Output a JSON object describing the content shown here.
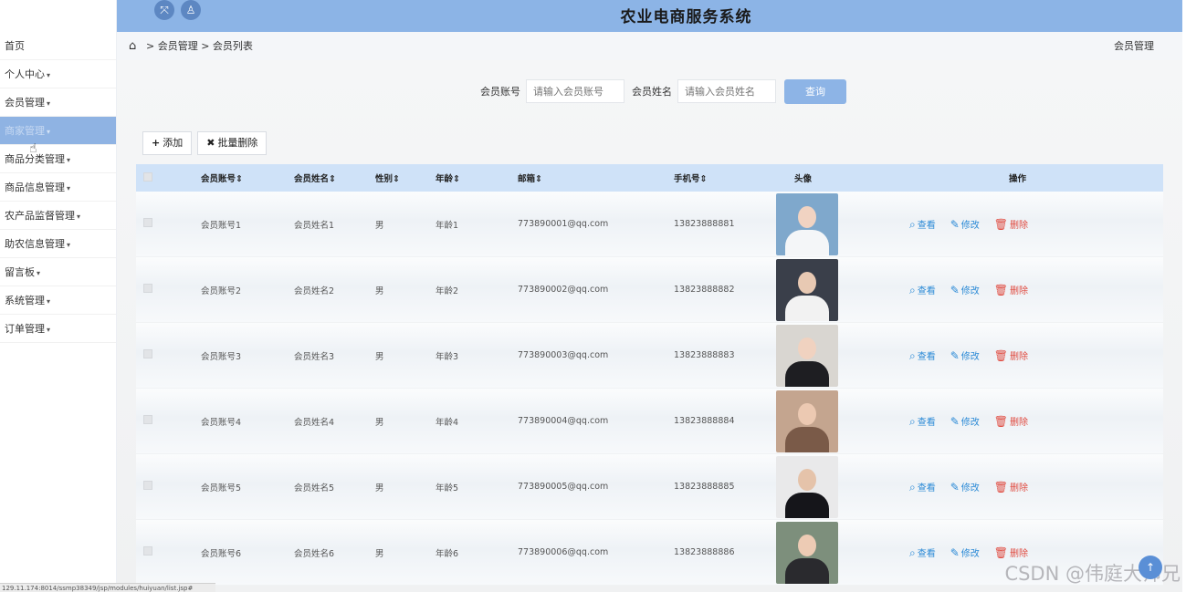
{
  "header": {
    "title": "农业电商服务系统",
    "icons": [
      "fullscreen-icon",
      "user-icon"
    ]
  },
  "sidebar": {
    "items": [
      {
        "label": "首页",
        "caret": ""
      },
      {
        "label": "个人中心",
        "caret": "▾"
      },
      {
        "label": "会员管理",
        "caret": "▾"
      },
      {
        "label": "商家管理",
        "caret": "▾"
      },
      {
        "label": "商品分类管理",
        "caret": "▾"
      },
      {
        "label": "商品信息管理",
        "caret": "▾"
      },
      {
        "label": "农产品监督管理",
        "caret": "▾"
      },
      {
        "label": "助农信息管理",
        "caret": "▾"
      },
      {
        "label": "留言板",
        "caret": "▾"
      },
      {
        "label": "系统管理",
        "caret": "▾"
      },
      {
        "label": "订单管理",
        "caret": "▾"
      }
    ]
  },
  "breadcrumb": {
    "path": "> 会员管理 > 会员列表",
    "right": "会员管理"
  },
  "search": {
    "account_label": "会员账号",
    "account_placeholder": "请输入会员账号",
    "name_label": "会员姓名",
    "name_placeholder": "请输入会员姓名",
    "query_button": "查询"
  },
  "toolbar": {
    "add_label": "添加",
    "batch_delete_label": "批量删除"
  },
  "table": {
    "headers": {
      "account": "会员账号⇕",
      "name": "会员姓名⇕",
      "sex": "性别⇕",
      "age": "年龄⇕",
      "email": "邮箱⇕",
      "phone": "手机号⇕",
      "avatar": "头像",
      "ops": "操作"
    },
    "rows": [
      {
        "account": "会员账号1",
        "name": "会员姓名1",
        "sex": "男",
        "age": "年龄1",
        "email": "773890001@qq.com",
        "phone": "13823888881"
      },
      {
        "account": "会员账号2",
        "name": "会员姓名2",
        "sex": "男",
        "age": "年龄2",
        "email": "773890002@qq.com",
        "phone": "13823888882"
      },
      {
        "account": "会员账号3",
        "name": "会员姓名3",
        "sex": "男",
        "age": "年龄3",
        "email": "773890003@qq.com",
        "phone": "13823888883"
      },
      {
        "account": "会员账号4",
        "name": "会员姓名4",
        "sex": "男",
        "age": "年龄4",
        "email": "773890004@qq.com",
        "phone": "13823888884"
      },
      {
        "account": "会员账号5",
        "name": "会员姓名5",
        "sex": "男",
        "age": "年龄5",
        "email": "773890005@qq.com",
        "phone": "13823888885"
      },
      {
        "account": "会员账号6",
        "name": "会员姓名6",
        "sex": "男",
        "age": "年龄6",
        "email": "773890006@qq.com",
        "phone": "13823888886"
      }
    ],
    "ops": {
      "view": "查看",
      "edit": "修改",
      "delete": "删除"
    }
  },
  "colors": {
    "header_bg": "#8cb4e6",
    "active_menu_bg": "#8fb3e3",
    "table_header_bg": "#cfe2f8",
    "link_blue": "#2b8ad6",
    "delete_red": "#e04a3f"
  },
  "statusbar_text": "129.11.174:8014/ssmp38349/jsp/modules/huiyuan/list.jsp#",
  "watermark": "CSDN @伟庭大师兄"
}
